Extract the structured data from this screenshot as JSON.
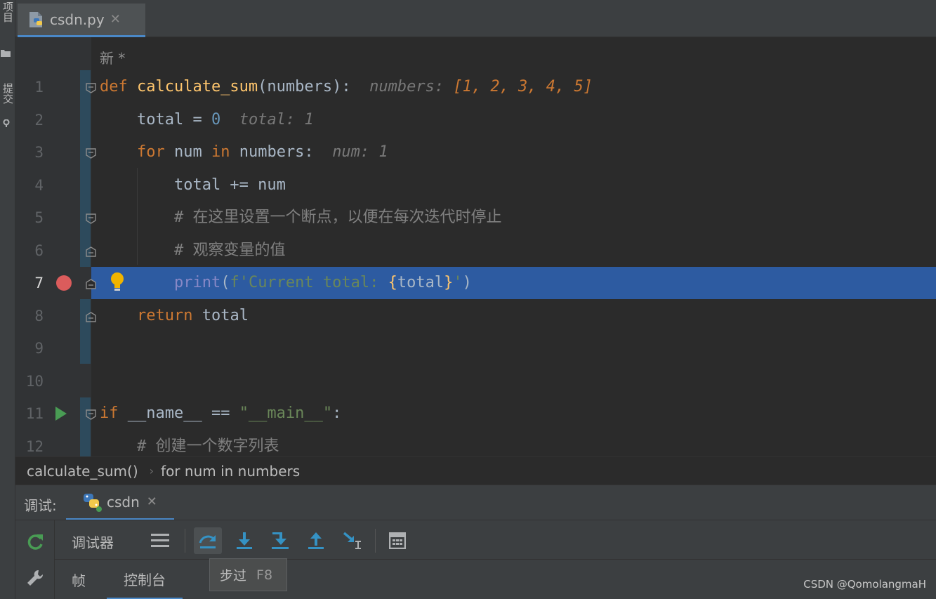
{
  "left_stripe": {
    "project_label": "项目",
    "commit_label": "提交"
  },
  "editor_tab": {
    "filename": "csdn.py",
    "close_glyph": "✕"
  },
  "editor": {
    "new_hint": "新 *",
    "lines": [
      {
        "n": "1",
        "tokens": [
          [
            "kw",
            "def "
          ],
          [
            "fn",
            "calculate_sum"
          ],
          [
            "p",
            "(numbers):"
          ],
          [
            "sp",
            "  "
          ],
          [
            "inl",
            "numbers: "
          ],
          [
            "inlv",
            "[1, 2, 3, 4, 5]"
          ]
        ]
      },
      {
        "n": "2",
        "tokens": [
          [
            "p",
            "    total = "
          ],
          [
            "num",
            "0"
          ],
          [
            "sp",
            "  "
          ],
          [
            "inl",
            "total: 1"
          ]
        ]
      },
      {
        "n": "3",
        "tokens": [
          [
            "p",
            "    "
          ],
          [
            "kw",
            "for"
          ],
          [
            "p",
            " num "
          ],
          [
            "kw",
            "in"
          ],
          [
            "p",
            " numbers:"
          ],
          [
            "sp",
            "  "
          ],
          [
            "inl",
            "num: 1"
          ]
        ]
      },
      {
        "n": "4",
        "tokens": [
          [
            "p",
            "        total += num"
          ]
        ]
      },
      {
        "n": "5",
        "tokens": [
          [
            "p",
            "        "
          ],
          [
            "cmt",
            "# 在这里设置一个断点，以便在每次迭代时停止"
          ]
        ]
      },
      {
        "n": "6",
        "tokens": [
          [
            "p",
            "        "
          ],
          [
            "cmt",
            "# 观察变量的值"
          ]
        ]
      },
      {
        "n": "7",
        "tokens": [
          [
            "p",
            "        "
          ],
          [
            "builtin",
            "print"
          ],
          [
            "p",
            "("
          ],
          [
            "str",
            "f'Current total: "
          ],
          [
            "fn",
            "{"
          ],
          [
            "p",
            "total"
          ],
          [
            "fn",
            "}"
          ],
          [
            "str",
            "'"
          ],
          [
            "p",
            ")"
          ]
        ]
      },
      {
        "n": "8",
        "tokens": [
          [
            "p",
            "    "
          ],
          [
            "kw",
            "return"
          ],
          [
            "p",
            " total"
          ]
        ]
      },
      {
        "n": "9",
        "tokens": []
      },
      {
        "n": "10",
        "tokens": []
      },
      {
        "n": "11",
        "tokens": [
          [
            "kw",
            "if"
          ],
          [
            "p",
            " __name__ == "
          ],
          [
            "str",
            "\"__main__\""
          ],
          [
            "p",
            ":"
          ]
        ]
      },
      {
        "n": "12",
        "tokens": [
          [
            "p",
            "    "
          ],
          [
            "cmt",
            "# 创建一个数字列表"
          ]
        ]
      }
    ]
  },
  "breadcrumb": {
    "items": [
      "calculate_sum()",
      "for num in numbers"
    ],
    "separator": "›"
  },
  "debug": {
    "title": "调试:",
    "session_tab": "csdn",
    "close_glyph": "✕",
    "toolbar_label": "调试器",
    "subtabs": [
      "帧",
      "控制台"
    ],
    "tooltip": {
      "text": "步过",
      "shortcut": "F8"
    }
  },
  "watermark": "CSDN @QomolangmaH",
  "colors": {
    "execution_line": "#2d5ba1",
    "breakpoint": "#db5c5c",
    "run_arrow": "#499c54",
    "accent": "#4a88c7"
  }
}
